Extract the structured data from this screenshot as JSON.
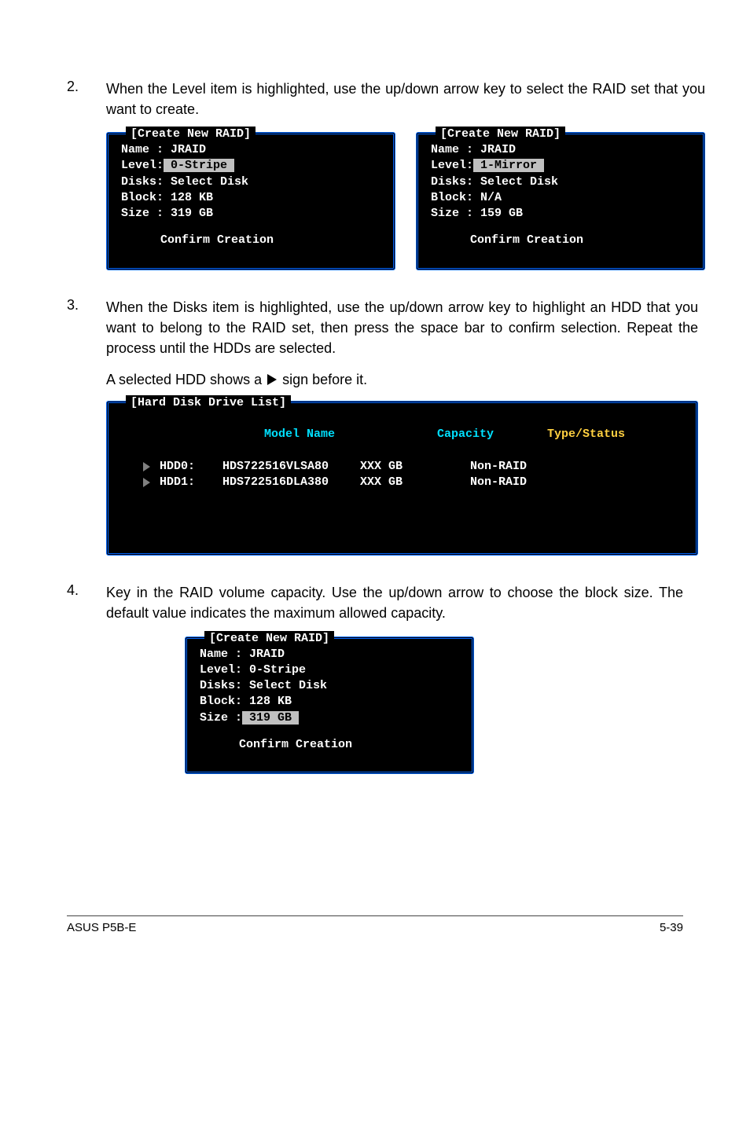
{
  "steps": [
    {
      "num": "2.",
      "text": "When the Level item is highlighted, use the up/down arrow key to select the RAID set that you want to create."
    },
    {
      "num": "3.",
      "text": "When the Disks item is highlighted, use the up/down arrow key to highlight an HDD that you want to belong to the RAID set, then press the space bar to confirm selection. Repeat the process until the HDDs are selected.",
      "sub_prefix": "A selected HDD shows a ",
      "sub_suffix": " sign before it."
    },
    {
      "num": "4.",
      "text": "Key in the RAID volume capacity. Use the up/down arrow to choose the block size. The default value indicates the maximum allowed capacity."
    }
  ],
  "panel_left": {
    "title": "[Create New RAID]",
    "lines": {
      "name": "Name : JRAID",
      "level_label": "Level:",
      "level_value": " 0-Stripe ",
      "disks": "Disks: Select Disk",
      "block": "Block: 128 KB",
      "size": "Size : 319 GB",
      "confirm": "Confirm Creation"
    }
  },
  "panel_right": {
    "title": "[Create New RAID]",
    "lines": {
      "name": "Name : JRAID",
      "level_label": "Level:",
      "level_value": " 1-Mirror ",
      "disks": "Disks: Select Disk",
      "block": "Block: N/A",
      "size": "Size : 159 GB",
      "confirm": "Confirm Creation"
    }
  },
  "drive_list": {
    "title": "[Hard Disk Drive List]",
    "headers": {
      "model": "Model Name",
      "capacity": "Capacity",
      "type": "Type/Status"
    },
    "rows": [
      {
        "label": "HDD0:",
        "model": "HDS722516VLSA80",
        "cap": "XXX GB",
        "type": "Non-RAID"
      },
      {
        "label": "HDD1:",
        "model": "HDS722516DLA380",
        "cap": "XXX GB",
        "type": "Non-RAID"
      }
    ]
  },
  "panel_size": {
    "title": "[Create New RAID]",
    "lines": {
      "name": "Name : JRAID",
      "level": "Level: 0-Stripe",
      "disks": "Disks: Select Disk",
      "block": "Block: 128 KB",
      "size_label": "Size :",
      "size_value": " 319 GB ",
      "confirm": "Confirm Creation"
    }
  },
  "footer": {
    "left": "ASUS P5B-E",
    "right": "5-39"
  }
}
